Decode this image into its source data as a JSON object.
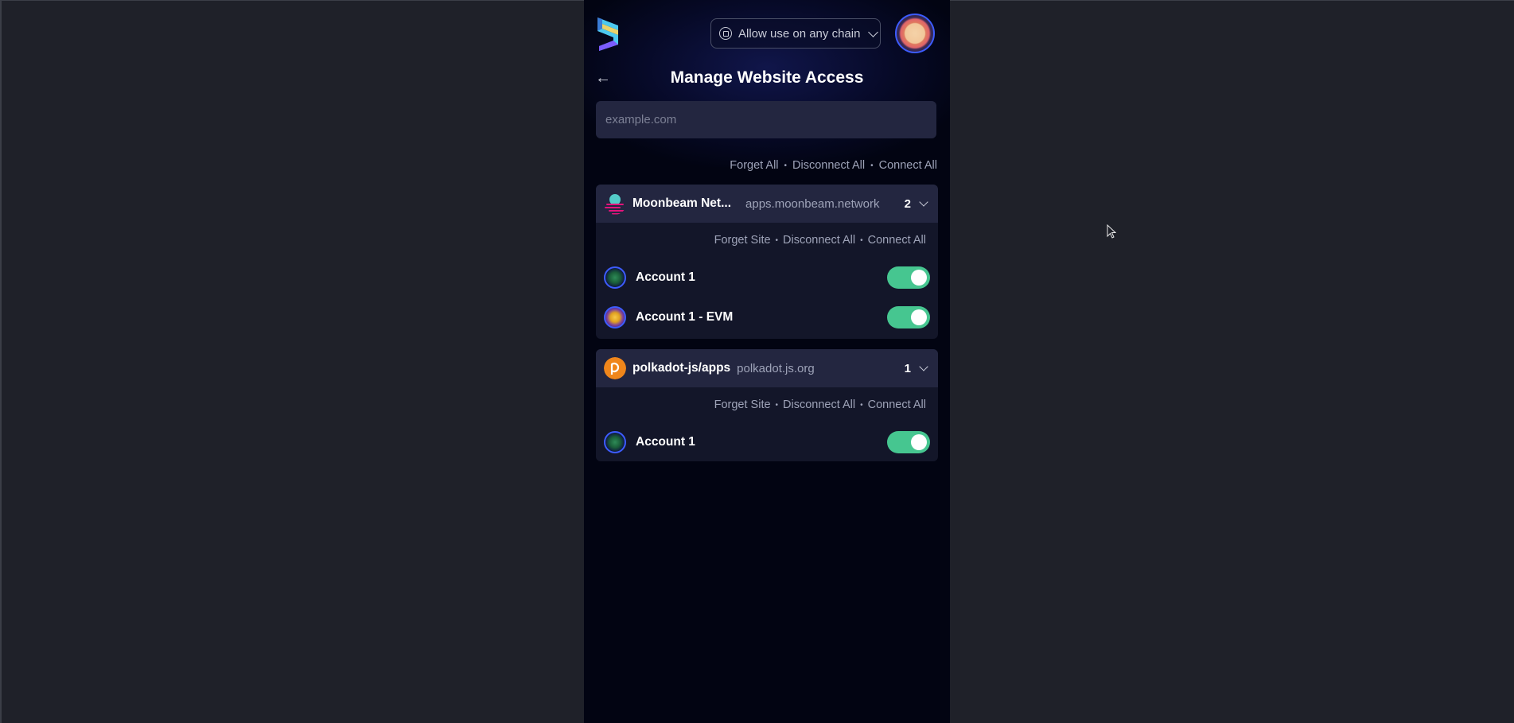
{
  "header": {
    "chain_select_label": "Allow use on any chain",
    "title": "Manage Website Access",
    "back_icon": "arrow-left-icon"
  },
  "search": {
    "placeholder": "example.com",
    "value": ""
  },
  "global_actions": {
    "forget": "Forget All",
    "disconnect": "Disconnect All",
    "connect": "Connect All"
  },
  "sites": [
    {
      "name": "Moonbeam Net...",
      "url": "apps.moonbeam.network",
      "count": "2",
      "actions": {
        "forget": "Forget Site",
        "disconnect": "Disconnect All",
        "connect": "Connect All"
      },
      "accounts": [
        {
          "name": "Account 1",
          "connected": true
        },
        {
          "name": "Account 1 - EVM",
          "connected": true
        }
      ]
    },
    {
      "name": "polkadot-js/apps",
      "url": "polkadot.js.org",
      "count": "1",
      "actions": {
        "forget": "Forget Site",
        "disconnect": "Disconnect All",
        "connect": "Connect All"
      },
      "accounts": [
        {
          "name": "Account 1",
          "connected": true
        }
      ]
    }
  ],
  "colors": {
    "background": "#1f2129",
    "panel": "#020412",
    "toggle_on": "#46c690",
    "accent": "#3d5cff"
  }
}
